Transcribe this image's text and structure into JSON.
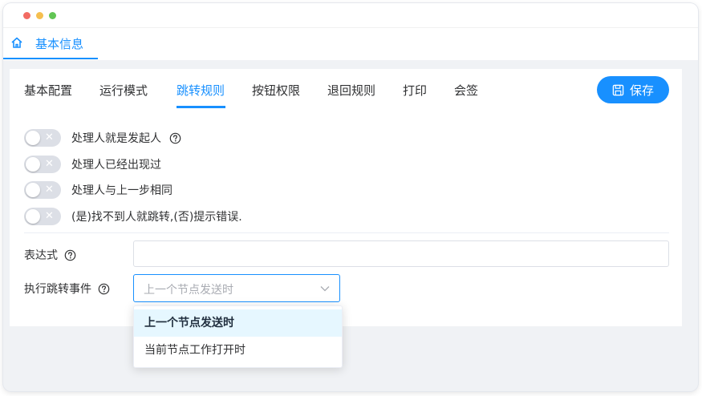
{
  "page_tab": {
    "label": "基本信息",
    "icon": "home-icon"
  },
  "tabs": [
    {
      "label": "基本配置",
      "active": false
    },
    {
      "label": "运行模式",
      "active": false
    },
    {
      "label": "跳转规则",
      "active": true
    },
    {
      "label": "按钮权限",
      "active": false
    },
    {
      "label": "退回规则",
      "active": false
    },
    {
      "label": "打印",
      "active": false
    },
    {
      "label": "会签",
      "active": false
    }
  ],
  "save_button": {
    "label": "保存",
    "icon": "save-icon"
  },
  "switches": [
    {
      "label": "处理人就是发起人",
      "checked": false,
      "has_help": true
    },
    {
      "label": "处理人已经出现过",
      "checked": false,
      "has_help": false
    },
    {
      "label": "处理人与上一步相同",
      "checked": false,
      "has_help": false
    },
    {
      "label": "(是)找不到人就跳转,(否)提示错误.",
      "checked": false,
      "has_help": false
    }
  ],
  "switch_off_glyph": "✕",
  "expression": {
    "label": "表达式",
    "value": ""
  },
  "jump_event": {
    "label": "执行跳转事件",
    "placeholder": "上一个节点发送时",
    "options": [
      {
        "label": "上一个节点发送时",
        "highlighted": true
      },
      {
        "label": "当前节点工作打开时",
        "highlighted": false
      }
    ]
  },
  "colors": {
    "accent": "#1890ff",
    "switch_off": "#dcdfe6",
    "option_highlight": "#e6f7ff"
  }
}
